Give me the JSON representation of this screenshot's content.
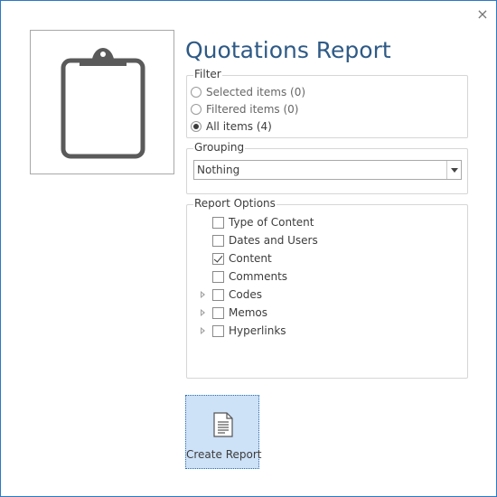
{
  "dialog": {
    "title": "Quotations Report",
    "close_glyph": "×",
    "close_icon": "close-icon",
    "image_icon": "clipboard-icon"
  },
  "filter": {
    "legend": "Filter",
    "options": [
      {
        "label": "Selected items (0)",
        "checked": false
      },
      {
        "label": "Filtered items (0)",
        "checked": false
      },
      {
        "label": "All items (4)",
        "checked": true
      }
    ]
  },
  "grouping": {
    "legend": "Grouping",
    "selected": "Nothing"
  },
  "report_options": {
    "legend": "Report Options",
    "items": [
      {
        "label": "Type of Content",
        "checked": false,
        "expandable": false
      },
      {
        "label": "Dates and Users",
        "checked": false,
        "expandable": false
      },
      {
        "label": "Content",
        "checked": true,
        "expandable": false
      },
      {
        "label": "Comments",
        "checked": false,
        "expandable": false
      },
      {
        "label": "Codes",
        "checked": false,
        "expandable": true
      },
      {
        "label": "Memos",
        "checked": false,
        "expandable": true
      },
      {
        "label": "Hyperlinks",
        "checked": false,
        "expandable": true
      }
    ]
  },
  "actions": {
    "create_report_label": "Create Report",
    "create_report_icon": "document-icon"
  },
  "colors": {
    "title": "#2e5a86",
    "window_border": "#2b78c5",
    "button_background": "#cde1f7"
  }
}
